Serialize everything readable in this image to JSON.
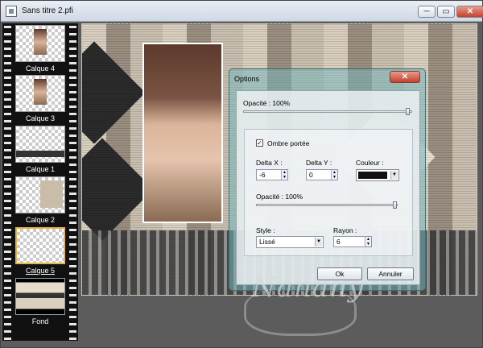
{
  "window": {
    "title": "Sans titre 2.pfi",
    "min": "─",
    "max": "▭",
    "close": "✕"
  },
  "layers": [
    {
      "label": "Calque 4"
    },
    {
      "label": "Calque 3"
    },
    {
      "label": "Calque 1"
    },
    {
      "label": "Calque 2"
    },
    {
      "label": "Calque 5",
      "selected": true
    },
    {
      "label": "Fond"
    }
  ],
  "dialog": {
    "title": "Options",
    "close": "✕",
    "opacity_top": "Opacité : 100%",
    "shadow_check": "Ombre portée",
    "delta_x_label": "Delta X :",
    "delta_x": "-6",
    "delta_y_label": "Delta Y :",
    "delta_y": "0",
    "color_label": "Couleur :",
    "opacity_inner": "Opacité : 100%",
    "style_label": "Style :",
    "style_value": "Lissé",
    "radius_label": "Rayon :",
    "radius_value": "6",
    "ok": "Ok",
    "cancel": "Annuler"
  },
  "colors": {
    "shadow_color": "#111111",
    "selection": "#e8b24a"
  },
  "watermark": "Nanany"
}
